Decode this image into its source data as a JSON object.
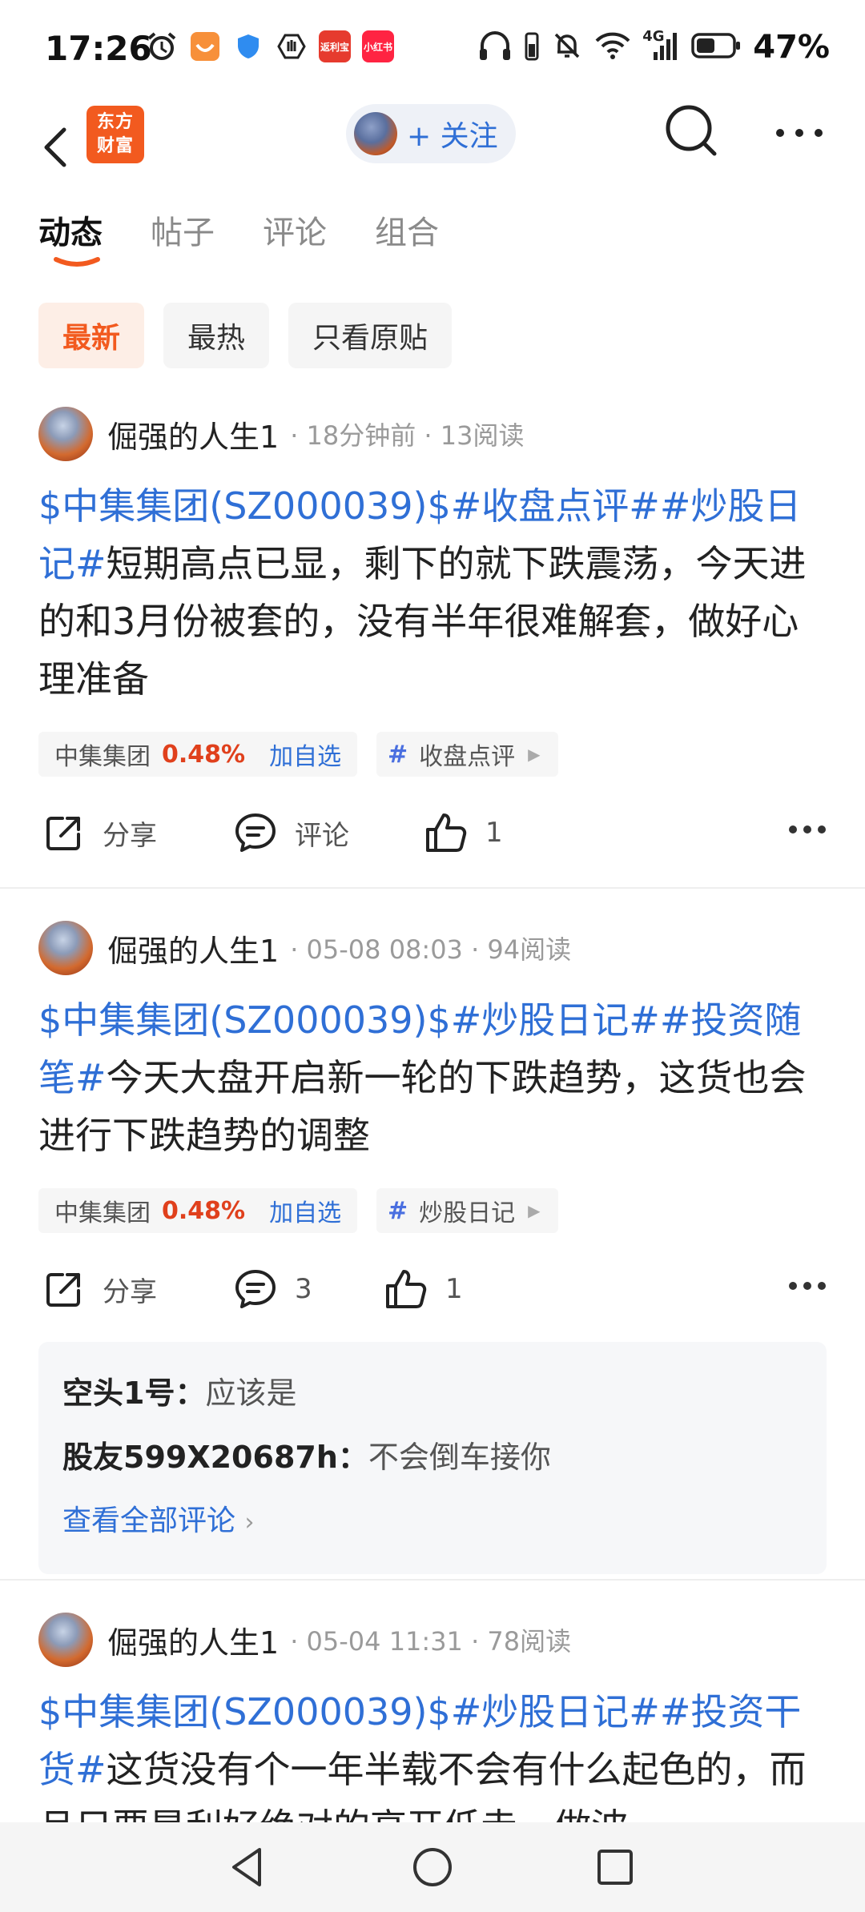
{
  "status_bar": {
    "time": "17:26",
    "battery": "47%",
    "network": "4G",
    "app_badge_1": "返利宝",
    "app_badge_2": "小红书"
  },
  "header": {
    "logo_line1": "东方",
    "logo_line2": "财富",
    "follow_label": "+ 关注"
  },
  "tabs": [
    "动态",
    "帖子",
    "评论",
    "组合"
  ],
  "filters": [
    "最新",
    "最热",
    "只看原贴"
  ],
  "posts": [
    {
      "author": "倔强的人生1",
      "meta": "· 18分钟前 · 13阅读",
      "link_text": "$中集集团(SZ000039)$#收盘点评##炒股日记#",
      "body": "短期高点已显，剩下的就下跌震荡，今天进的和3月份被套的，没有半年很难解套，做好心理准备",
      "stock_name": "中集集团",
      "stock_pct": "0.48%",
      "stock_add": "加自选",
      "topic": "收盘点评",
      "share": "分享",
      "comment": "评论",
      "likes": "1"
    },
    {
      "author": "倔强的人生1",
      "meta": "· 05-08 08:03 · 94阅读",
      "link_text": "$中集集团(SZ000039)$#炒股日记##投资随笔#",
      "body": "今天大盘开启新一轮的下跌趋势，这货也会进行下跌趋势的调整",
      "stock_name": "中集集团",
      "stock_pct": "0.48%",
      "stock_add": "加自选",
      "topic": "炒股日记",
      "share": "分享",
      "comment": "3",
      "likes": "1",
      "comments": [
        {
          "user": "空头1号",
          "sep": "：",
          "text": "应该是"
        },
        {
          "user": "股友599X20687h",
          "sep": "：",
          "text": "不会倒车接你"
        }
      ],
      "view_all": "查看全部评论"
    },
    {
      "author": "倔强的人生1",
      "meta": "· 05-04 11:31 · 78阅读",
      "link_text": "$中集集团(SZ000039)$#炒股日记##投资干货#",
      "body": "这货没有个一年半载不会有什么起色的，而且只要是利好绝对的高开低走，做波"
    }
  ],
  "colors": {
    "accent": "#f25a1f",
    "link": "#2f6fd6",
    "rise": "#e0401c"
  }
}
